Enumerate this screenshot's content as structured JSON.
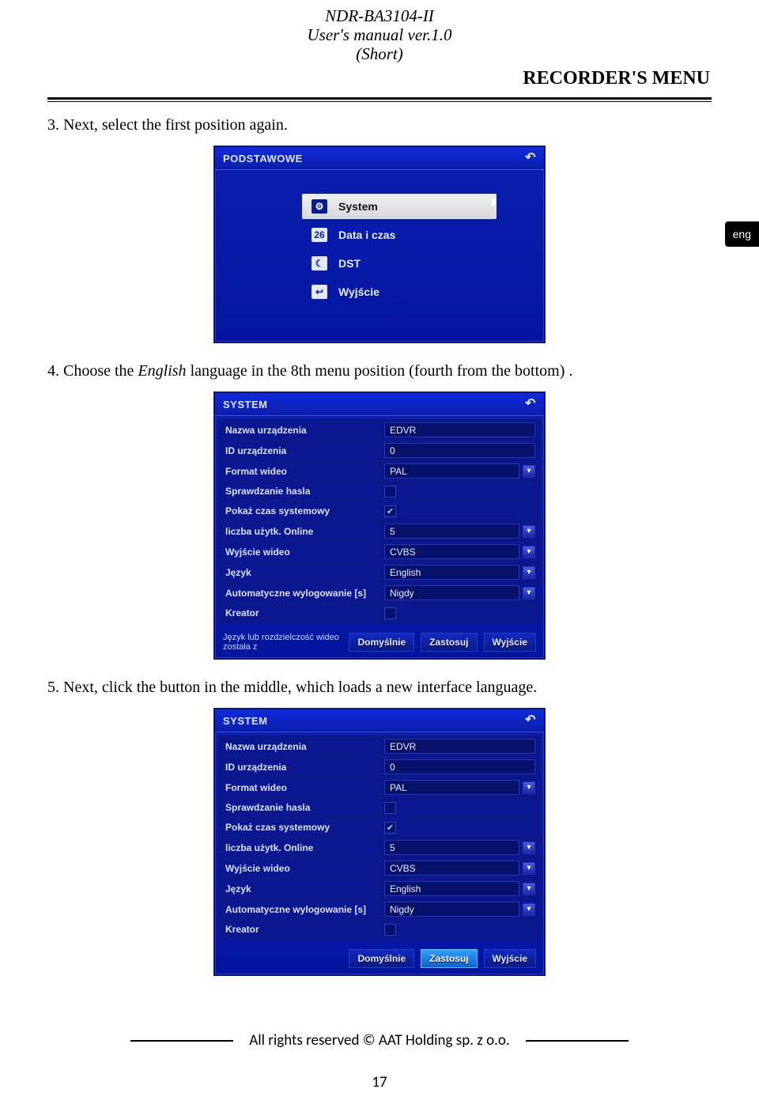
{
  "header": {
    "model": "NDR-BA3104-II",
    "manual_line": "User's manual ver.1.0",
    "short_line": "(Short)",
    "section": "RECORDER'S MENU"
  },
  "lang_tab": "eng",
  "steps": {
    "s3": "3. Next, select the first position again.",
    "s4_pre": "4. Choose the ",
    "s4_em": "English",
    "s4_post": " language in the 8th menu position  (fourth from the bottom) .",
    "s5": "5. Next, click the button in the middle, which loads a new interface language."
  },
  "panel1": {
    "title": "PODSTAWOWE",
    "items": [
      {
        "icon": "⚙",
        "label": "System",
        "selected": true
      },
      {
        "icon": "26",
        "label": "Data i czas",
        "selected": false
      },
      {
        "icon": "☾",
        "label": "DST",
        "selected": false
      },
      {
        "icon": "↩",
        "label": "Wyjście",
        "selected": false
      }
    ]
  },
  "system_form": {
    "title": "SYSTEM",
    "rows": [
      {
        "label": "Nazwa urządzenia",
        "type": "text",
        "value": "EDVR"
      },
      {
        "label": "ID urządzenia",
        "type": "text",
        "value": "0"
      },
      {
        "label": "Format wideo",
        "type": "dropdown",
        "value": "PAL"
      },
      {
        "label": "Sprawdzanie hasla",
        "type": "check",
        "checked": false
      },
      {
        "label": "Pokaż czas systemowy",
        "type": "check",
        "checked": true
      },
      {
        "label": "liczba użytk. Online",
        "type": "dropdown",
        "value": "5"
      },
      {
        "label": "Wyjście wideo",
        "type": "dropdown",
        "value": "CVBS"
      },
      {
        "label": "Język",
        "type": "dropdown",
        "value": "English"
      },
      {
        "label": "Automatyczne wylogowanie [s]",
        "type": "dropdown",
        "value": "Nigdy"
      },
      {
        "label": "Kreator",
        "type": "check",
        "checked": false
      }
    ],
    "hint": "Język lub rozdzielczość wideo została z",
    "buttons": {
      "default": "Domyślnie",
      "apply": "Zastosuj",
      "exit": "Wyjście"
    }
  },
  "footer": {
    "rights": "All rights reserved © AAT Holding sp. z o.o.",
    "page": "17"
  }
}
